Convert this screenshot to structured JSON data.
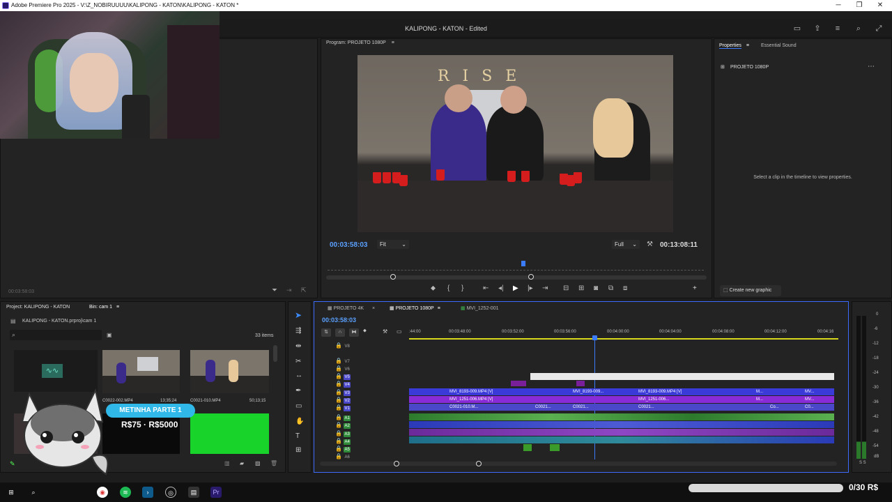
{
  "window": {
    "title": "Adobe Premiere Pro 2025 - V:\\Z_NOBIRUUUU\\KALIPONG - KATON\\KALIPONG - KATON *",
    "controls": {
      "minimize": "─",
      "maximize": "❐",
      "close": "✕"
    }
  },
  "header": {
    "project_title": "KALIPONG - KATON",
    "status": "- Edited"
  },
  "left_panel": {
    "timecode": "00:03:58:03"
  },
  "program": {
    "title": "Program: PROJETO 1080P",
    "timecode": "00:03:58:03",
    "fit": "Fit",
    "quality": "Full",
    "duration": "00:13:08:11",
    "sign": "R I S E"
  },
  "properties": {
    "tabs": [
      {
        "label": "Properties"
      },
      {
        "label": "Essential Sound"
      }
    ],
    "sequence": "PROJETO 1080P",
    "empty_message": "Select a clip in the timeline to view properties.",
    "create_button": "Create new graphic"
  },
  "project": {
    "title": "Project: KALIPONG - KATON",
    "bin": "Bin: cam 1",
    "path": "KALIPONG - KATON.prproj\\cam 1",
    "count": "33 items",
    "thumbs": [
      {
        "name": "C0022-002.MP4",
        "duration": "13;35;24"
      },
      {
        "name": "C0021-010.MP4",
        "duration": "50;13;15"
      }
    ]
  },
  "overlay": {
    "banner": "METINHA PARTE 1",
    "price": "R$75 · R$5000"
  },
  "timeline": {
    "tabs": [
      {
        "label": "PROJETO 4K"
      },
      {
        "label": "PROJETO 1080P"
      },
      {
        "label": "MVI_1252-001"
      }
    ],
    "timecode": "00:03:58:03",
    "ruler": [
      ":44:00",
      "00:03:48:00",
      "00:03:52:00",
      "00:03:56:00",
      "00:04:00:00",
      "00:04:04:00",
      "00:04:08:00",
      "00:04:12:00",
      "00:04:16"
    ],
    "video_tracks": [
      "V8",
      "V7",
      "V6",
      "V5",
      "V4",
      "V3",
      "V2",
      "V1"
    ],
    "audio_tracks": [
      "A1",
      "A2",
      "A3",
      "A4",
      "A5",
      "A6"
    ],
    "clips": {
      "v3a": "MVI_8193-009.MP4 [V]",
      "v3b": "MVI_8193-009...",
      "v3c": "MVI_8193-009.MP4 [V]",
      "v3d": "M...",
      "v3e": "MV...",
      "v2a": "MVI_1251-006.MP4 [V]",
      "v2b": "MVI_1251-006...",
      "v2c": "M...",
      "v2d": "MV...",
      "v1a": "C0021-010.M...",
      "v1b": "C0021...",
      "v1c": "C0021...",
      "v1d": "C0021...",
      "v1e": "Co...",
      "v1f": "C0..."
    }
  },
  "meters": {
    "scale": [
      "0",
      "-6",
      "-12",
      "-18",
      "-24",
      "-30",
      "-36",
      "-42",
      "-48",
      "-54",
      "dB"
    ],
    "solo": "S S"
  },
  "donation": {
    "text": "0/30 R$"
  },
  "colors": {
    "accent": "#3b6cff",
    "timecode": "#5aa0ff",
    "video_track": "#4a48c8",
    "audio_track": "#2f8a3a",
    "clip_purple": "#8a2bd8",
    "clip_blue": "#3a3ad8"
  }
}
